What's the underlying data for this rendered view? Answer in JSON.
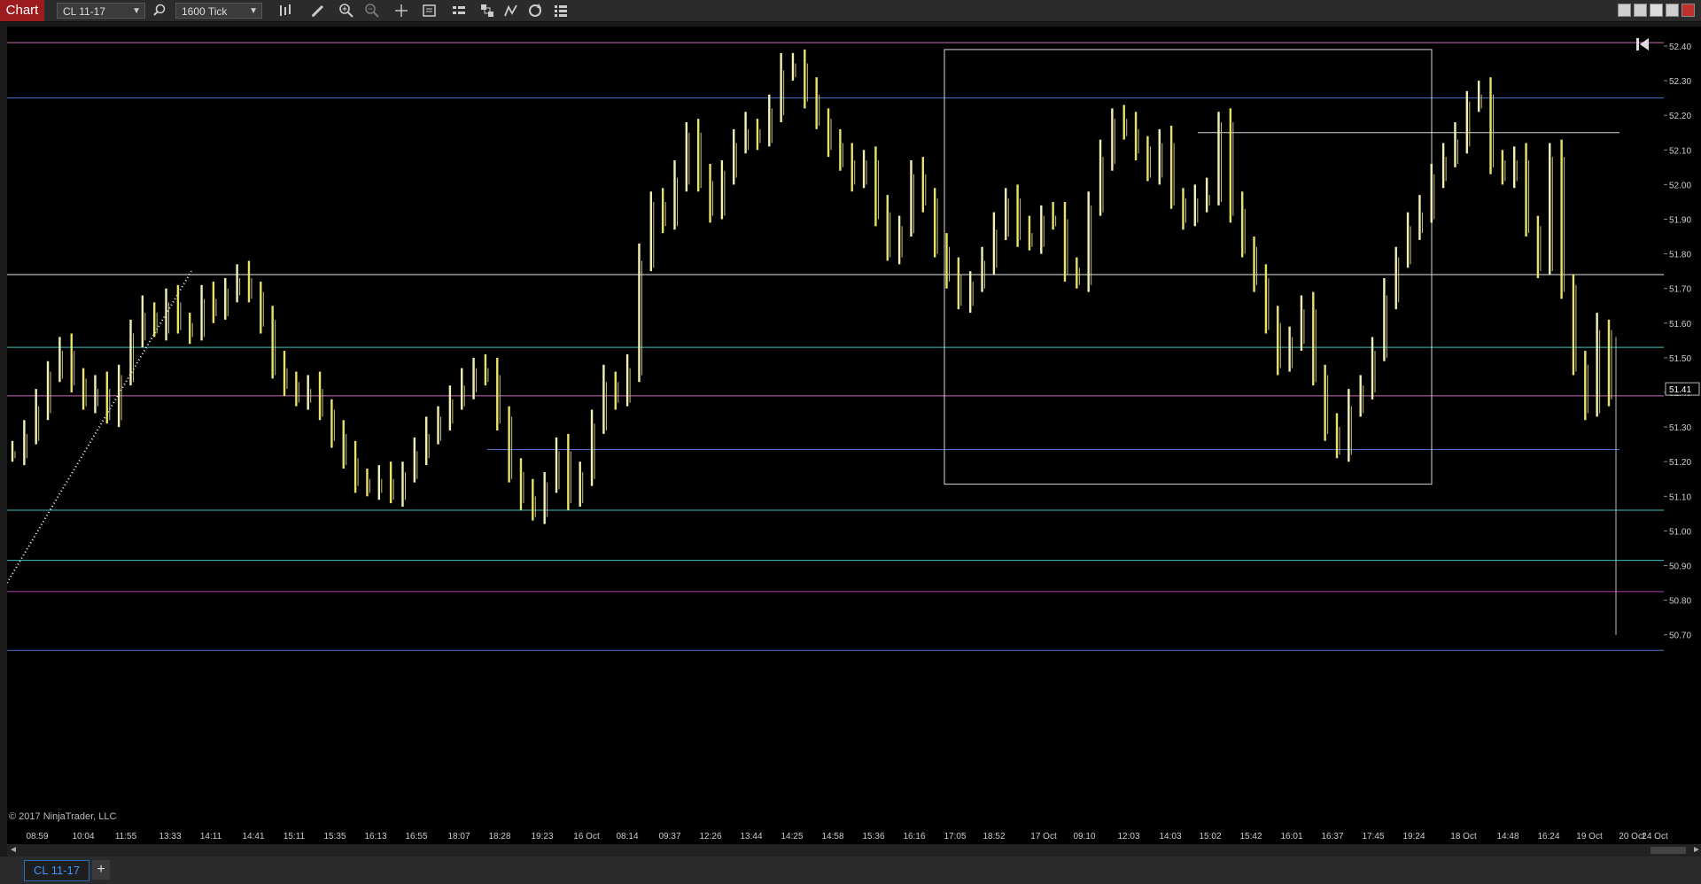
{
  "toolbar": {
    "title": "Chart",
    "instrument": "CL 11-17",
    "interval": "1600 Tick",
    "icons": [
      "search-icon",
      "bar-type-icon",
      "pencil-icon",
      "zoom-in-icon",
      "zoom-out-icon",
      "crosshair-icon",
      "properties-icon",
      "data-box-icon",
      "strategies-icon",
      "indicators-icon",
      "reload-icon",
      "list-icon"
    ]
  },
  "window_controls": [
    "restore-icon",
    "maximize-icon",
    "minimize-icon",
    "popout-icon",
    "close-icon"
  ],
  "chart_data": {
    "type": "ohlc-bar",
    "price_axis": {
      "ticks": [
        "52.40",
        "52.30",
        "52.20",
        "52.10",
        "52.00",
        "51.90",
        "51.80",
        "51.70",
        "51.60",
        "51.50",
        "51.40",
        "51.30",
        "51.20",
        "51.10",
        "51.00",
        "50.90",
        "50.80",
        "50.70"
      ],
      "ylim": [
        50.65,
        52.45
      ],
      "last_price": "51.41"
    },
    "time_axis": {
      "ticks": [
        "08:59",
        "10:04",
        "11:55",
        "13:33",
        "14:11",
        "14:41",
        "15:11",
        "15:35",
        "16:13",
        "16:55",
        "18:07",
        "18:28",
        "19:23",
        "16 Oct",
        "08:14",
        "09:37",
        "12:26",
        "13:44",
        "14:25",
        "14:58",
        "15:36",
        "16:16",
        "17:05",
        "18:52",
        "17 Oct",
        "09:10",
        "12:03",
        "14:03",
        "15:02",
        "15:42",
        "16:01",
        "16:37",
        "17:45",
        "19:24",
        "18 Oct",
        "14:48",
        "16:24",
        "19 Oct",
        "20 Oct",
        "24 Oct"
      ]
    },
    "horizontal_lines": [
      {
        "price": 52.41,
        "color": "#c86bb8"
      },
      {
        "price": 52.25,
        "color": "#4a73c8"
      },
      {
        "price": 51.74,
        "color": "#e6e6e6"
      },
      {
        "price": 51.53,
        "color": "#3bbfbf"
      },
      {
        "price": 51.39,
        "color": "#c86bb8"
      },
      {
        "price": 51.06,
        "color": "#3bbfbf"
      },
      {
        "price": 50.915,
        "color": "#3bbfbf"
      },
      {
        "price": 50.825,
        "color": "#b040b0"
      },
      {
        "price": 50.655,
        "color": "#4a73c8"
      }
    ],
    "segment_lines": [
      {
        "price": 51.235,
        "from_tick": "18:28",
        "color": "#4a73c8"
      },
      {
        "price": 52.15,
        "from_tick": "15:02",
        "color": "#d8d8d8"
      }
    ],
    "rectangle": {
      "price_top": 52.39,
      "price_bottom": 51.135,
      "from_tick": "17:05",
      "to_tick": "19:24"
    },
    "trend_line": {
      "from_price": 50.85,
      "to_price": 51.75,
      "from_tick": "08:59",
      "to_tick": "14:11"
    },
    "close_series": [
      51.23,
      51.28,
      51.36,
      51.46,
      51.52,
      51.44,
      51.38,
      51.41,
      51.34,
      51.45,
      51.57,
      51.63,
      51.59,
      51.66,
      51.6,
      51.58,
      51.67,
      51.64,
      51.7,
      51.73,
      51.69,
      51.61,
      51.47,
      51.43,
      51.39,
      51.41,
      51.35,
      51.28,
      51.21,
      51.15,
      51.13,
      51.15,
      51.11,
      51.17,
      51.23,
      51.28,
      51.33,
      51.38,
      51.42,
      51.47,
      51.45,
      51.33,
      51.17,
      51.1,
      51.06,
      51.14,
      51.23,
      51.1,
      51.17,
      51.31,
      51.43,
      51.39,
      51.47,
      51.78,
      51.95,
      51.9,
      52.02,
      52.15,
      52.01,
      51.93,
      52.04,
      52.12,
      52.16,
      52.14,
      52.22,
      52.33,
      52.35,
      52.26,
      52.19,
      52.12,
      52.07,
      52.02,
      52.07,
      51.92,
      51.81,
      51.88,
      52.03,
      51.96,
      51.82,
      51.74,
      51.67,
      51.72,
      51.78,
      51.87,
      51.96,
      51.86,
      51.84,
      51.91,
      51.9,
      51.76,
      51.73,
      51.94,
      52.08,
      52.19,
      52.16,
      52.11,
      52.04,
      52.12,
      51.96,
      51.91,
      51.96,
      51.97,
      52.18,
      51.93,
      51.82,
      51.73,
      51.6,
      51.49,
      51.56,
      51.64,
      51.45,
      51.3,
      51.24,
      51.36,
      51.42,
      51.52,
      51.68,
      51.79,
      51.88,
      51.92,
      52.03,
      52.08,
      52.13,
      52.24,
      52.26,
      52.07,
      52.03,
      52.07,
      51.88,
      51.77,
      52.08,
      51.71,
      51.48,
      51.36,
      51.58,
      51.4
    ]
  },
  "copyright": "© 2017 NinjaTrader, LLC",
  "tabs": [
    {
      "label": "CL 11-17"
    }
  ],
  "tab_add_label": "+"
}
